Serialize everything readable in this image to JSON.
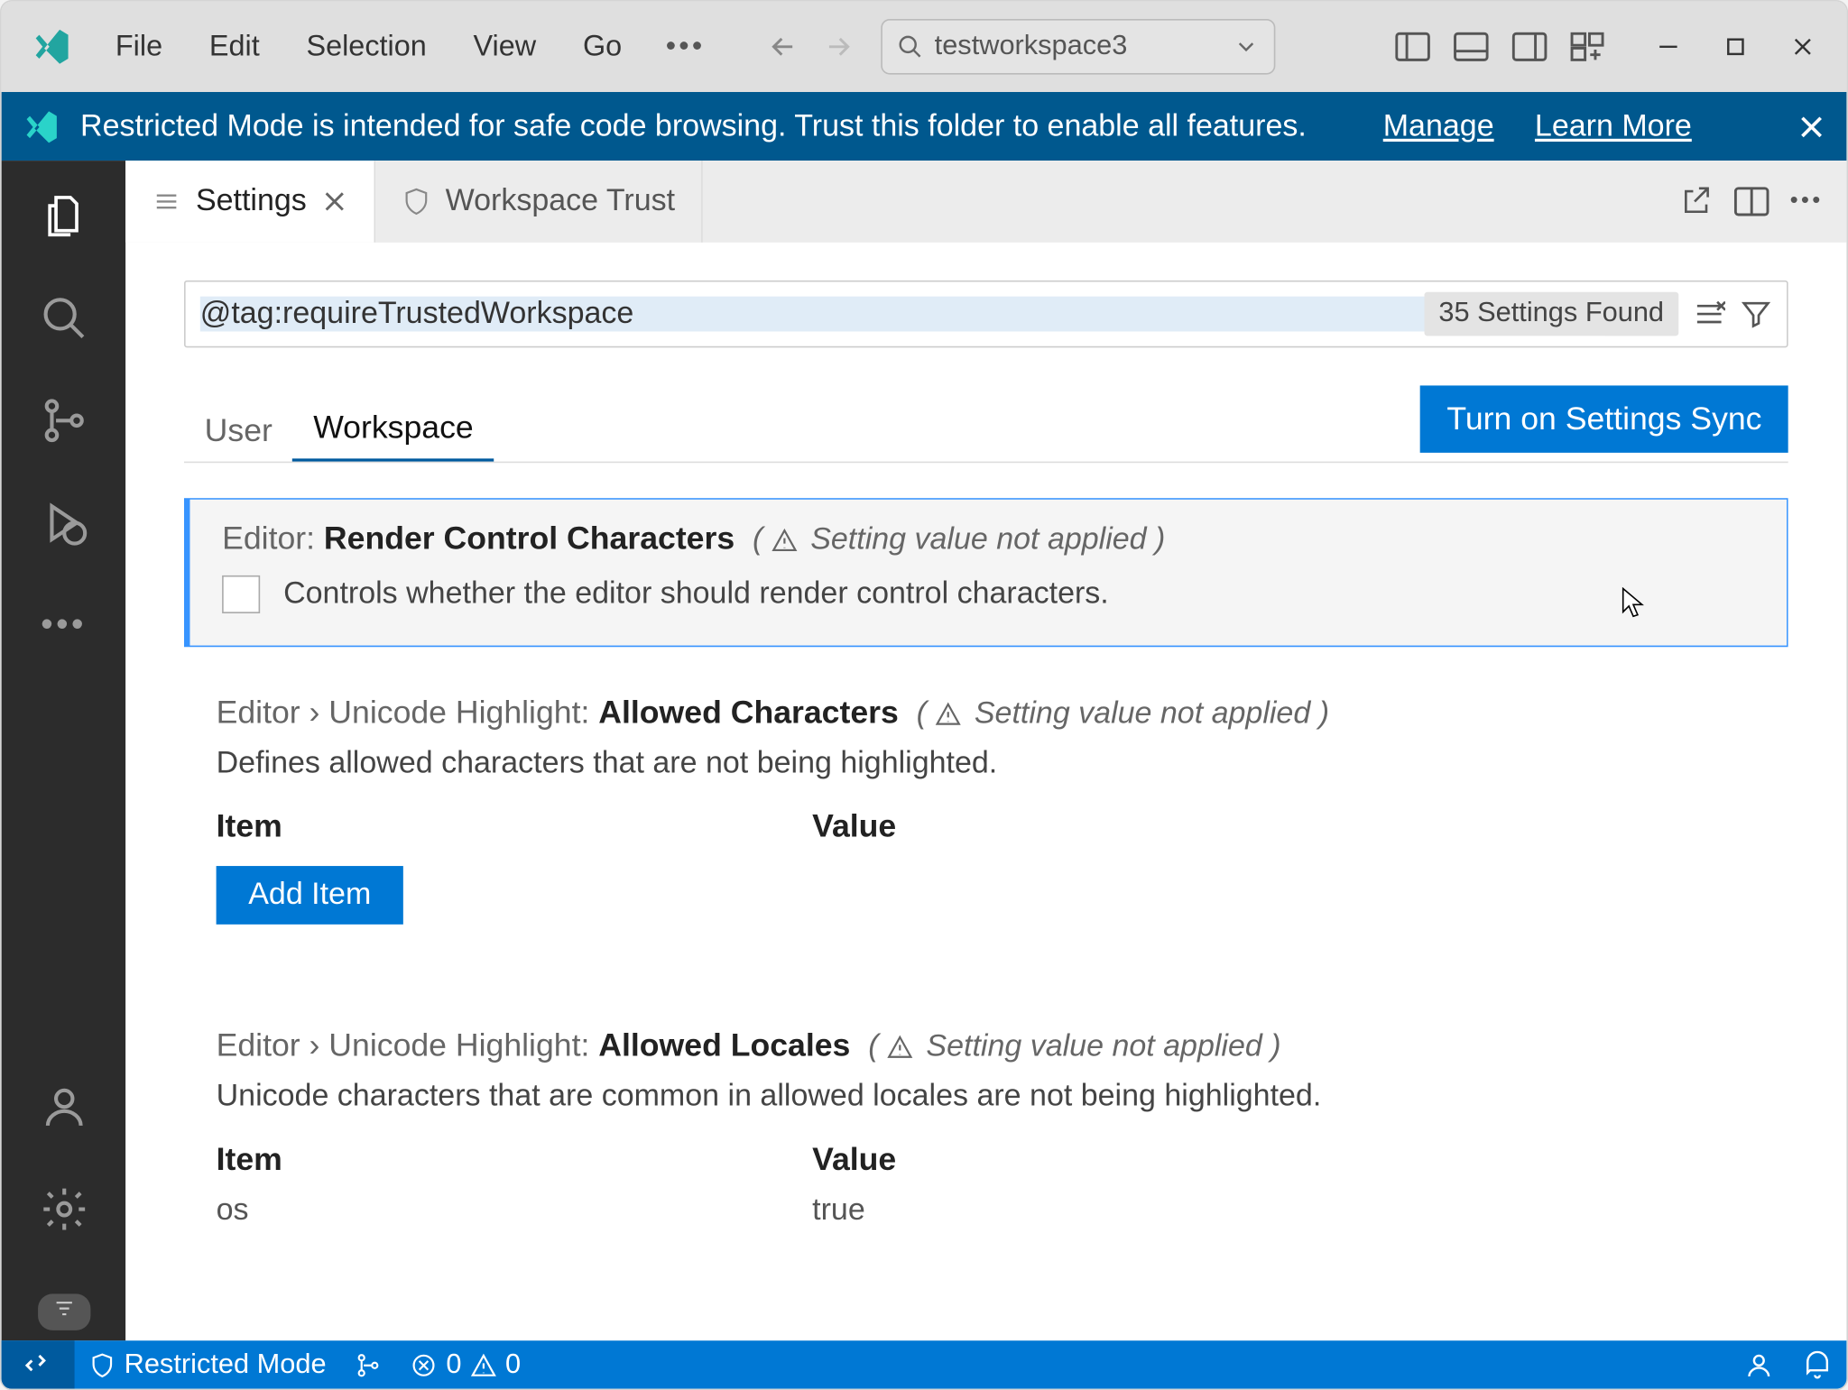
{
  "menu": {
    "file": "File",
    "edit": "Edit",
    "selection": "Selection",
    "view": "View",
    "go": "Go"
  },
  "commandCenter": "testworkspace3",
  "banner": {
    "text": "Restricted Mode is intended for safe code browsing. Trust this folder to enable all features.",
    "manage": "Manage",
    "learn": "Learn More"
  },
  "tabs": {
    "settings": "Settings",
    "trust": "Workspace Trust"
  },
  "search": {
    "value": "@tag:requireTrustedWorkspace",
    "found": "35 Settings Found"
  },
  "scope": {
    "user": "User",
    "workspace": "Workspace",
    "sync": "Turn on Settings Sync"
  },
  "warn": "Setting value not applied",
  "s1": {
    "prefix": "Editor: ",
    "name": "Render Control Characters",
    "desc": "Controls whether the editor should render control characters."
  },
  "s2": {
    "prefix": "Editor › Unicode Highlight: ",
    "name": "Allowed Characters",
    "desc": "Defines allowed characters that are not being highlighted.",
    "colItem": "Item",
    "colValue": "Value",
    "add": "Add Item"
  },
  "s3": {
    "prefix": "Editor › Unicode Highlight: ",
    "name": "Allowed Locales",
    "desc": "Unicode characters that are common in allowed locales are not being highlighted.",
    "colItem": "Item",
    "colValue": "Value",
    "row1Item": "os",
    "row1Value": "true"
  },
  "status": {
    "restricted": "Restricted Mode",
    "errors": "0",
    "warnings": "0"
  }
}
